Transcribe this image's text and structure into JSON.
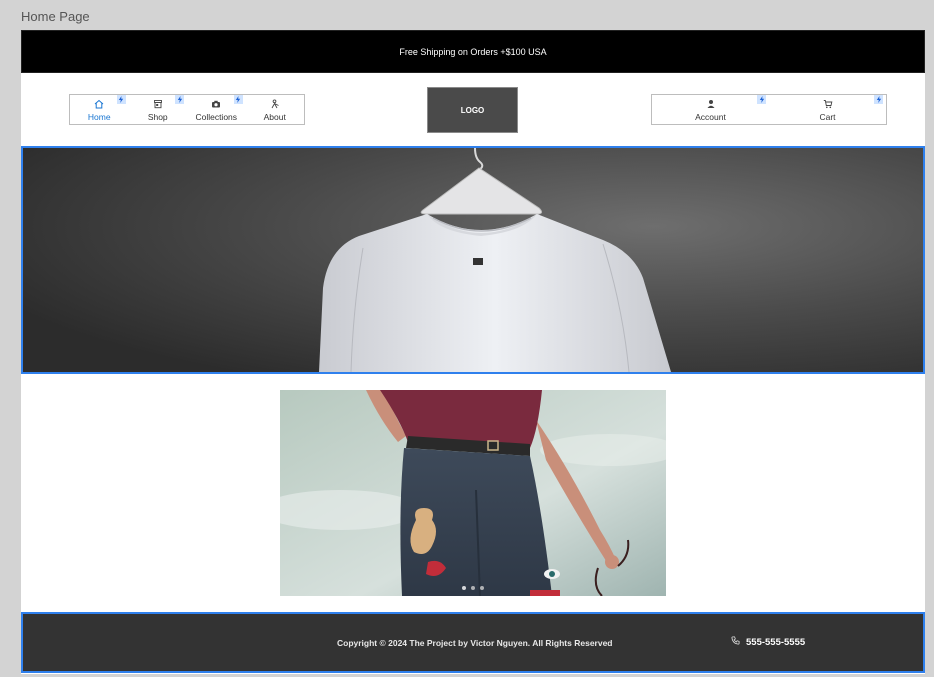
{
  "frame": {
    "label": "Home Page"
  },
  "promo": {
    "text": "Free Shipping on Orders +$100 USA"
  },
  "nav_left": [
    {
      "label": "Home",
      "icon": "home-icon",
      "active": true
    },
    {
      "label": "Shop",
      "icon": "store-icon",
      "active": false
    },
    {
      "label": "Collections",
      "icon": "collections-icon",
      "active": false
    },
    {
      "label": "About",
      "icon": "about-icon",
      "active": false
    }
  ],
  "logo": {
    "text": "LOGO"
  },
  "nav_right": [
    {
      "label": "Account",
      "icon": "account-icon"
    },
    {
      "label": "Cart",
      "icon": "cart-icon"
    }
  ],
  "footer": {
    "copyright": "Copyright © 2024 The Project by Victor Nguyen. All Rights Reserved",
    "phone": "555-555-5555"
  },
  "colors": {
    "accent": "#1976d2",
    "selection": "#2f80ed",
    "promo_bg": "#000000",
    "footer_bg": "#333333"
  },
  "carousel": {
    "slides": 3,
    "active_slide": 1
  }
}
